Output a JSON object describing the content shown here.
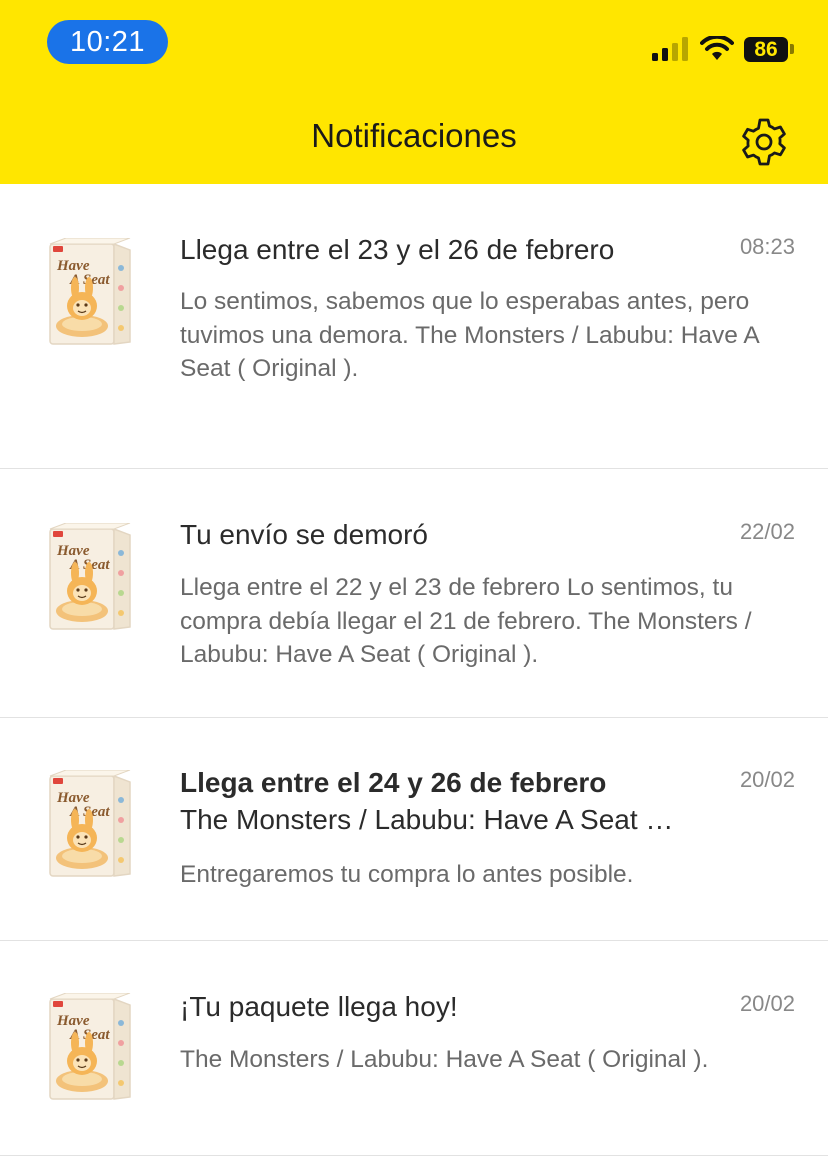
{
  "status_bar": {
    "time": "10:21",
    "battery": "86",
    "signal_icon": "cellular-signal-icon",
    "wifi_icon": "wifi-icon"
  },
  "header": {
    "title": "Notificaciones",
    "settings_icon": "gear-icon",
    "background_color": "#FFE600"
  },
  "notifications": [
    {
      "title": "Llega entre el 23 y el 26 de febrero",
      "time": "08:23",
      "body": "Lo sentimos, sabemos que lo esperabas antes, pero tuvimos una demora. The Monsters / Labubu: Have A Seat ( Original )."
    },
    {
      "title": "Tu envío se demoró",
      "time": "22/02",
      "body": "Llega entre el 22 y el 23 de febrero Lo sentimos, tu compra debía llegar el 21 de febrero. The Monsters / Labubu: Have A Seat ( Original )."
    },
    {
      "title": "Llega entre el 24 y 26 de febrero",
      "subtitle": "The Monsters / Labubu: Have A Seat ( Original )",
      "time": "20/02",
      "body": "Entregaremos tu compra lo antes posible."
    },
    {
      "title": "¡Tu paquete llega hoy!",
      "time": "20/02",
      "body": "The Monsters / Labubu: Have A Seat ( Original )."
    }
  ],
  "product_image": {
    "box_text": "Have A Seat",
    "icon": "product-box-thumbnail"
  }
}
